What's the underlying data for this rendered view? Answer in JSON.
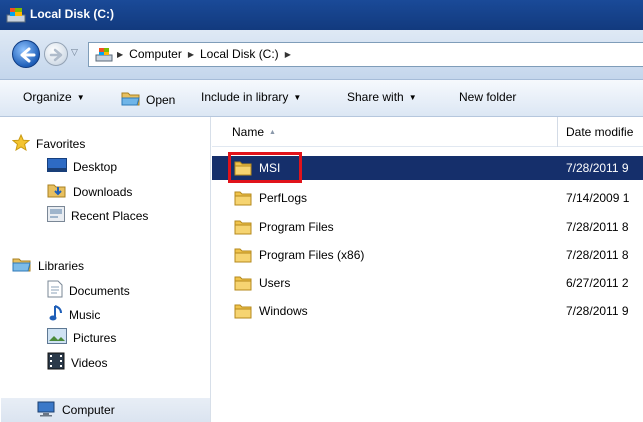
{
  "window": {
    "title": "Local Disk (C:)"
  },
  "address": {
    "crumbs": [
      "Computer",
      "Local Disk (C:)"
    ]
  },
  "toolbar": {
    "organize": "Organize",
    "open": "Open",
    "include": "Include in library",
    "share": "Share with",
    "new_folder": "New folder"
  },
  "nav": {
    "favorites": "Favorites",
    "desktop": "Desktop",
    "downloads": "Downloads",
    "recent": "Recent Places",
    "libraries": "Libraries",
    "documents": "Documents",
    "music": "Music",
    "pictures": "Pictures",
    "videos": "Videos",
    "computer": "Computer"
  },
  "columns": {
    "name": "Name",
    "date": "Date modifie"
  },
  "files": [
    {
      "name": "MSI",
      "date": "7/28/2011 9"
    },
    {
      "name": "PerfLogs",
      "date": "7/14/2009 1"
    },
    {
      "name": "Program Files",
      "date": "7/28/2011 8"
    },
    {
      "name": "Program Files (x86)",
      "date": "7/28/2011 8"
    },
    {
      "name": "Users",
      "date": "6/27/2011 2"
    },
    {
      "name": "Windows",
      "date": "7/28/2011 9"
    }
  ],
  "colors": {
    "selection": "#152f6b",
    "highlight_box": "#e1131b",
    "title_bar": "#1a4a98"
  }
}
